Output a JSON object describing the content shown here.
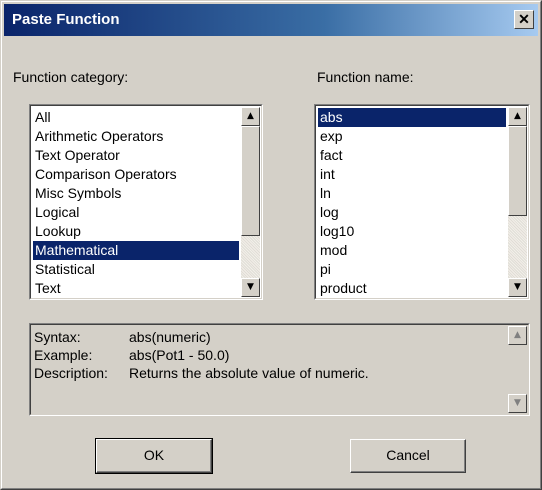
{
  "window": {
    "title": "Paste Function",
    "close_glyph": "✕"
  },
  "category": {
    "label": "Function category:",
    "items": [
      "All",
      "Arithmetic Operators",
      "Text Operator",
      "Comparison Operators",
      "Misc Symbols",
      "Logical",
      "Lookup",
      "Mathematical",
      "Statistical",
      "Text"
    ],
    "selected": "Mathematical"
  },
  "function_name": {
    "label": "Function name:",
    "items": [
      "abs",
      "exp",
      "fact",
      "int",
      "ln",
      "log",
      "log10",
      "mod",
      "pi",
      "product"
    ],
    "selected": "abs"
  },
  "description": {
    "syntax_label": "Syntax:",
    "syntax_value": "abs(numeric)",
    "example_label": "Example:",
    "example_value": "abs(Pot1 - 50.0)",
    "description_label": "Description:",
    "description_value": "Returns the absolute value of numeric."
  },
  "buttons": {
    "ok": "OK",
    "cancel": "Cancel"
  },
  "icons": {
    "up": "▲",
    "down": "▼"
  },
  "colors": {
    "title_start": "#0a246a",
    "selection": "#0a246a",
    "face": "#d4d0c8"
  }
}
